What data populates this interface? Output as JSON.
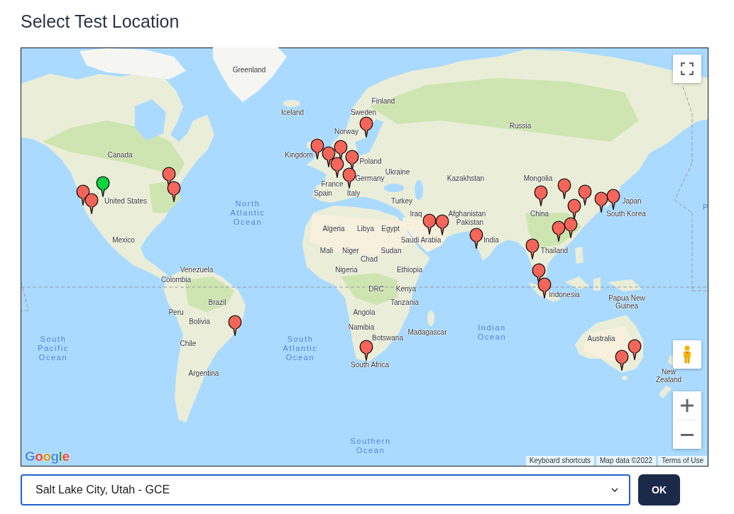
{
  "title": "Select Test Location",
  "map": {
    "labels": [
      {
        "kind": "country",
        "text": "Greenland"
      },
      {
        "kind": "country",
        "text": "Finland"
      },
      {
        "kind": "country",
        "text": "Iceland"
      },
      {
        "kind": "country",
        "text": "Sweden"
      },
      {
        "kind": "country",
        "text": "Russia"
      },
      {
        "kind": "country",
        "text": "Norway"
      },
      {
        "kind": "country",
        "text": "Canada"
      },
      {
        "kind": "country",
        "text": "Kingdom"
      },
      {
        "kind": "country",
        "text": "Poland"
      },
      {
        "kind": "country",
        "text": "Ukraine"
      },
      {
        "kind": "country",
        "text": "Germany"
      },
      {
        "kind": "country",
        "text": "Kazakhstan"
      },
      {
        "kind": "country",
        "text": "Mongolia"
      },
      {
        "kind": "country",
        "text": "France"
      },
      {
        "kind": "country",
        "text": "Spain"
      },
      {
        "kind": "country",
        "text": "Italy"
      },
      {
        "kind": "country",
        "text": "United States"
      },
      {
        "kind": "country",
        "text": "Turkey"
      },
      {
        "kind": "country",
        "text": "Japan"
      },
      {
        "kind": "ocean",
        "text": "P"
      },
      {
        "kind": "ocean",
        "text": "North Atlantic Ocean"
      },
      {
        "kind": "country",
        "text": "Iraq"
      },
      {
        "kind": "country",
        "text": "Afghanistan"
      },
      {
        "kind": "country",
        "text": "China"
      },
      {
        "kind": "country",
        "text": "South Korea"
      },
      {
        "kind": "country",
        "text": "Pakistan"
      },
      {
        "kind": "country",
        "text": "Algeria"
      },
      {
        "kind": "country",
        "text": "Libya"
      },
      {
        "kind": "country",
        "text": "Egypt"
      },
      {
        "kind": "country",
        "text": "Mexico"
      },
      {
        "kind": "country",
        "text": "Saudi Arabia"
      },
      {
        "kind": "country",
        "text": "India"
      },
      {
        "kind": "country",
        "text": "Mali"
      },
      {
        "kind": "country",
        "text": "Niger"
      },
      {
        "kind": "country",
        "text": "Sudan"
      },
      {
        "kind": "country",
        "text": "Thailand"
      },
      {
        "kind": "country",
        "text": "Chad"
      },
      {
        "kind": "country",
        "text": "Venezuela"
      },
      {
        "kind": "country",
        "text": "Nigeria"
      },
      {
        "kind": "country",
        "text": "Ethiopia"
      },
      {
        "kind": "country",
        "text": "Colombia"
      },
      {
        "kind": "country",
        "text": "DRC"
      },
      {
        "kind": "country",
        "text": "Kenya"
      },
      {
        "kind": "country",
        "text": "Indonesia"
      },
      {
        "kind": "country",
        "text": "Brazil"
      },
      {
        "kind": "country",
        "text": "Tanzania"
      },
      {
        "kind": "country",
        "text": "Papua New Guinea"
      },
      {
        "kind": "country",
        "text": "Peru"
      },
      {
        "kind": "country",
        "text": "Angola"
      },
      {
        "kind": "country",
        "text": "Bolivia"
      },
      {
        "kind": "country",
        "text": "Namibia"
      },
      {
        "kind": "country",
        "text": "Madagascar"
      },
      {
        "kind": "country",
        "text": "Botswana"
      },
      {
        "kind": "ocean",
        "text": "Indian Ocean"
      },
      {
        "kind": "country",
        "text": "Australia"
      },
      {
        "kind": "country",
        "text": "Chile"
      },
      {
        "kind": "ocean",
        "text": "South Pacific Ocean"
      },
      {
        "kind": "ocean",
        "text": "South Atlantic Ocean"
      },
      {
        "kind": "country",
        "text": "South Africa"
      },
      {
        "kind": "country",
        "text": "Argentina"
      },
      {
        "kind": "country",
        "text": "New Zealand"
      },
      {
        "kind": "ocean",
        "text": "Southern Ocean"
      }
    ],
    "pins": [
      {
        "selected": true
      },
      {
        "selected": false
      },
      {
        "selected": false
      },
      {
        "selected": false
      },
      {
        "selected": false
      },
      {
        "selected": false
      },
      {
        "selected": false
      },
      {
        "selected": false
      },
      {
        "selected": false
      },
      {
        "selected": false
      },
      {
        "selected": false
      },
      {
        "selected": false
      },
      {
        "selected": false
      },
      {
        "selected": false
      },
      {
        "selected": false
      },
      {
        "selected": false
      },
      {
        "selected": false
      },
      {
        "selected": false
      },
      {
        "selected": false
      },
      {
        "selected": false
      },
      {
        "selected": false
      },
      {
        "selected": false
      },
      {
        "selected": false
      },
      {
        "selected": false
      },
      {
        "selected": false
      },
      {
        "selected": false
      },
      {
        "selected": false
      },
      {
        "selected": false
      },
      {
        "selected": false
      },
      {
        "selected": false
      }
    ],
    "logo": "Google",
    "attribution": [
      "Keyboard shortcuts",
      "Map data ©2022",
      "Terms of Use"
    ]
  },
  "location_select": {
    "value": "Salt Lake City, Utah - GCE"
  },
  "buttons": [
    {
      "label": "OK"
    }
  ]
}
